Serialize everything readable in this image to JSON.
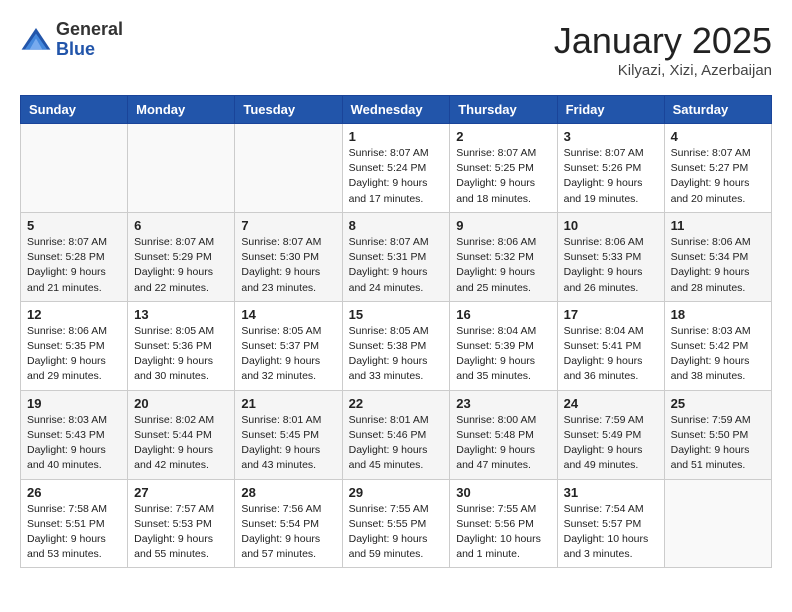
{
  "header": {
    "logo_general": "General",
    "logo_blue": "Blue",
    "title": "January 2025",
    "location": "Kilyazi, Xizi, Azerbaijan"
  },
  "days_of_week": [
    "Sunday",
    "Monday",
    "Tuesday",
    "Wednesday",
    "Thursday",
    "Friday",
    "Saturday"
  ],
  "weeks": [
    [
      {
        "day": "",
        "sunrise": "",
        "sunset": "",
        "daylight": ""
      },
      {
        "day": "",
        "sunrise": "",
        "sunset": "",
        "daylight": ""
      },
      {
        "day": "",
        "sunrise": "",
        "sunset": "",
        "daylight": ""
      },
      {
        "day": "1",
        "sunrise": "Sunrise: 8:07 AM",
        "sunset": "Sunset: 5:24 PM",
        "daylight": "Daylight: 9 hours and 17 minutes."
      },
      {
        "day": "2",
        "sunrise": "Sunrise: 8:07 AM",
        "sunset": "Sunset: 5:25 PM",
        "daylight": "Daylight: 9 hours and 18 minutes."
      },
      {
        "day": "3",
        "sunrise": "Sunrise: 8:07 AM",
        "sunset": "Sunset: 5:26 PM",
        "daylight": "Daylight: 9 hours and 19 minutes."
      },
      {
        "day": "4",
        "sunrise": "Sunrise: 8:07 AM",
        "sunset": "Sunset: 5:27 PM",
        "daylight": "Daylight: 9 hours and 20 minutes."
      }
    ],
    [
      {
        "day": "5",
        "sunrise": "Sunrise: 8:07 AM",
        "sunset": "Sunset: 5:28 PM",
        "daylight": "Daylight: 9 hours and 21 minutes."
      },
      {
        "day": "6",
        "sunrise": "Sunrise: 8:07 AM",
        "sunset": "Sunset: 5:29 PM",
        "daylight": "Daylight: 9 hours and 22 minutes."
      },
      {
        "day": "7",
        "sunrise": "Sunrise: 8:07 AM",
        "sunset": "Sunset: 5:30 PM",
        "daylight": "Daylight: 9 hours and 23 minutes."
      },
      {
        "day": "8",
        "sunrise": "Sunrise: 8:07 AM",
        "sunset": "Sunset: 5:31 PM",
        "daylight": "Daylight: 9 hours and 24 minutes."
      },
      {
        "day": "9",
        "sunrise": "Sunrise: 8:06 AM",
        "sunset": "Sunset: 5:32 PM",
        "daylight": "Daylight: 9 hours and 25 minutes."
      },
      {
        "day": "10",
        "sunrise": "Sunrise: 8:06 AM",
        "sunset": "Sunset: 5:33 PM",
        "daylight": "Daylight: 9 hours and 26 minutes."
      },
      {
        "day": "11",
        "sunrise": "Sunrise: 8:06 AM",
        "sunset": "Sunset: 5:34 PM",
        "daylight": "Daylight: 9 hours and 28 minutes."
      }
    ],
    [
      {
        "day": "12",
        "sunrise": "Sunrise: 8:06 AM",
        "sunset": "Sunset: 5:35 PM",
        "daylight": "Daylight: 9 hours and 29 minutes."
      },
      {
        "day": "13",
        "sunrise": "Sunrise: 8:05 AM",
        "sunset": "Sunset: 5:36 PM",
        "daylight": "Daylight: 9 hours and 30 minutes."
      },
      {
        "day": "14",
        "sunrise": "Sunrise: 8:05 AM",
        "sunset": "Sunset: 5:37 PM",
        "daylight": "Daylight: 9 hours and 32 minutes."
      },
      {
        "day": "15",
        "sunrise": "Sunrise: 8:05 AM",
        "sunset": "Sunset: 5:38 PM",
        "daylight": "Daylight: 9 hours and 33 minutes."
      },
      {
        "day": "16",
        "sunrise": "Sunrise: 8:04 AM",
        "sunset": "Sunset: 5:39 PM",
        "daylight": "Daylight: 9 hours and 35 minutes."
      },
      {
        "day": "17",
        "sunrise": "Sunrise: 8:04 AM",
        "sunset": "Sunset: 5:41 PM",
        "daylight": "Daylight: 9 hours and 36 minutes."
      },
      {
        "day": "18",
        "sunrise": "Sunrise: 8:03 AM",
        "sunset": "Sunset: 5:42 PM",
        "daylight": "Daylight: 9 hours and 38 minutes."
      }
    ],
    [
      {
        "day": "19",
        "sunrise": "Sunrise: 8:03 AM",
        "sunset": "Sunset: 5:43 PM",
        "daylight": "Daylight: 9 hours and 40 minutes."
      },
      {
        "day": "20",
        "sunrise": "Sunrise: 8:02 AM",
        "sunset": "Sunset: 5:44 PM",
        "daylight": "Daylight: 9 hours and 42 minutes."
      },
      {
        "day": "21",
        "sunrise": "Sunrise: 8:01 AM",
        "sunset": "Sunset: 5:45 PM",
        "daylight": "Daylight: 9 hours and 43 minutes."
      },
      {
        "day": "22",
        "sunrise": "Sunrise: 8:01 AM",
        "sunset": "Sunset: 5:46 PM",
        "daylight": "Daylight: 9 hours and 45 minutes."
      },
      {
        "day": "23",
        "sunrise": "Sunrise: 8:00 AM",
        "sunset": "Sunset: 5:48 PM",
        "daylight": "Daylight: 9 hours and 47 minutes."
      },
      {
        "day": "24",
        "sunrise": "Sunrise: 7:59 AM",
        "sunset": "Sunset: 5:49 PM",
        "daylight": "Daylight: 9 hours and 49 minutes."
      },
      {
        "day": "25",
        "sunrise": "Sunrise: 7:59 AM",
        "sunset": "Sunset: 5:50 PM",
        "daylight": "Daylight: 9 hours and 51 minutes."
      }
    ],
    [
      {
        "day": "26",
        "sunrise": "Sunrise: 7:58 AM",
        "sunset": "Sunset: 5:51 PM",
        "daylight": "Daylight: 9 hours and 53 minutes."
      },
      {
        "day": "27",
        "sunrise": "Sunrise: 7:57 AM",
        "sunset": "Sunset: 5:53 PM",
        "daylight": "Daylight: 9 hours and 55 minutes."
      },
      {
        "day": "28",
        "sunrise": "Sunrise: 7:56 AM",
        "sunset": "Sunset: 5:54 PM",
        "daylight": "Daylight: 9 hours and 57 minutes."
      },
      {
        "day": "29",
        "sunrise": "Sunrise: 7:55 AM",
        "sunset": "Sunset: 5:55 PM",
        "daylight": "Daylight: 9 hours and 59 minutes."
      },
      {
        "day": "30",
        "sunrise": "Sunrise: 7:55 AM",
        "sunset": "Sunset: 5:56 PM",
        "daylight": "Daylight: 10 hours and 1 minute."
      },
      {
        "day": "31",
        "sunrise": "Sunrise: 7:54 AM",
        "sunset": "Sunset: 5:57 PM",
        "daylight": "Daylight: 10 hours and 3 minutes."
      },
      {
        "day": "",
        "sunrise": "",
        "sunset": "",
        "daylight": ""
      }
    ]
  ]
}
